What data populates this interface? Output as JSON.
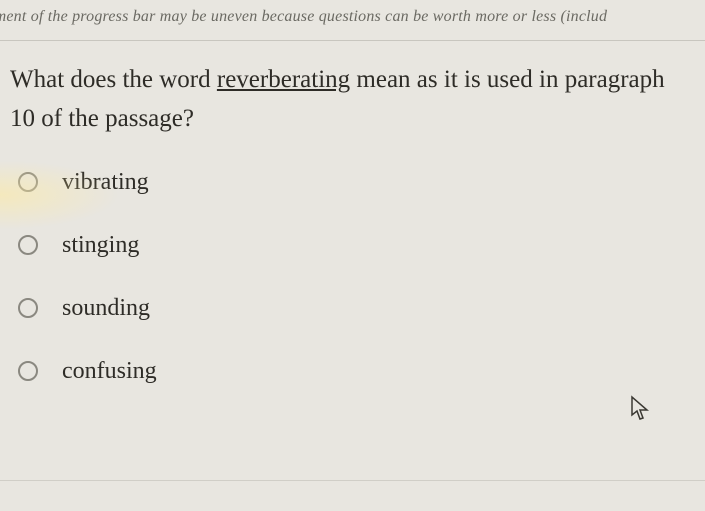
{
  "hint": "vement of the progress bar may be uneven because questions can be worth more or less (includ",
  "question": {
    "part1": "What does the word ",
    "underlined": "reverberating",
    "part2": " mean as it is used in paragraph",
    "line2": "10 of the passage?"
  },
  "options": [
    {
      "label": "vibrating"
    },
    {
      "label": "stinging"
    },
    {
      "label": "sounding"
    },
    {
      "label": "confusing"
    }
  ]
}
